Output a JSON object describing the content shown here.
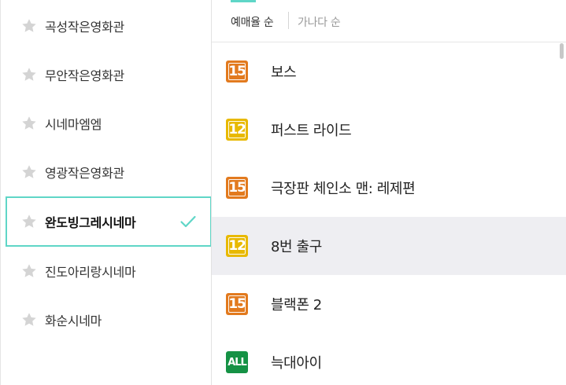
{
  "theaters": [
    {
      "name": "곡성작은영화관",
      "selected": false
    },
    {
      "name": "무안작은영화관",
      "selected": false
    },
    {
      "name": "시네마엠엠",
      "selected": false
    },
    {
      "name": "영광작은영화관",
      "selected": false
    },
    {
      "name": "완도빙그레시네마",
      "selected": true
    },
    {
      "name": "진도아리랑시네마",
      "selected": false
    },
    {
      "name": "화순시네마",
      "selected": false
    }
  ],
  "sort": {
    "active_label": "예매율 순",
    "inactive_label": "가나다 순"
  },
  "movies": [
    {
      "title": "보스",
      "rating": "15",
      "highlighted": false
    },
    {
      "title": "퍼스트 라이드",
      "rating": "12",
      "highlighted": false
    },
    {
      "title": "극장판 체인소 맨: 레제편",
      "rating": "15",
      "highlighted": false
    },
    {
      "title": "8번 출구",
      "rating": "12",
      "highlighted": true
    },
    {
      "title": "블랙폰 2",
      "rating": "15",
      "highlighted": false
    },
    {
      "title": "늑대아이",
      "rating": "ALL",
      "highlighted": false
    }
  ],
  "colors": {
    "accent": "#5fd6c7",
    "rating_15": "#e27a1e",
    "rating_12": "#e8b900",
    "rating_all": "#159245",
    "highlight_row": "#eeeef2"
  },
  "icons": {
    "favorite": "star-icon",
    "selected": "check-icon"
  }
}
